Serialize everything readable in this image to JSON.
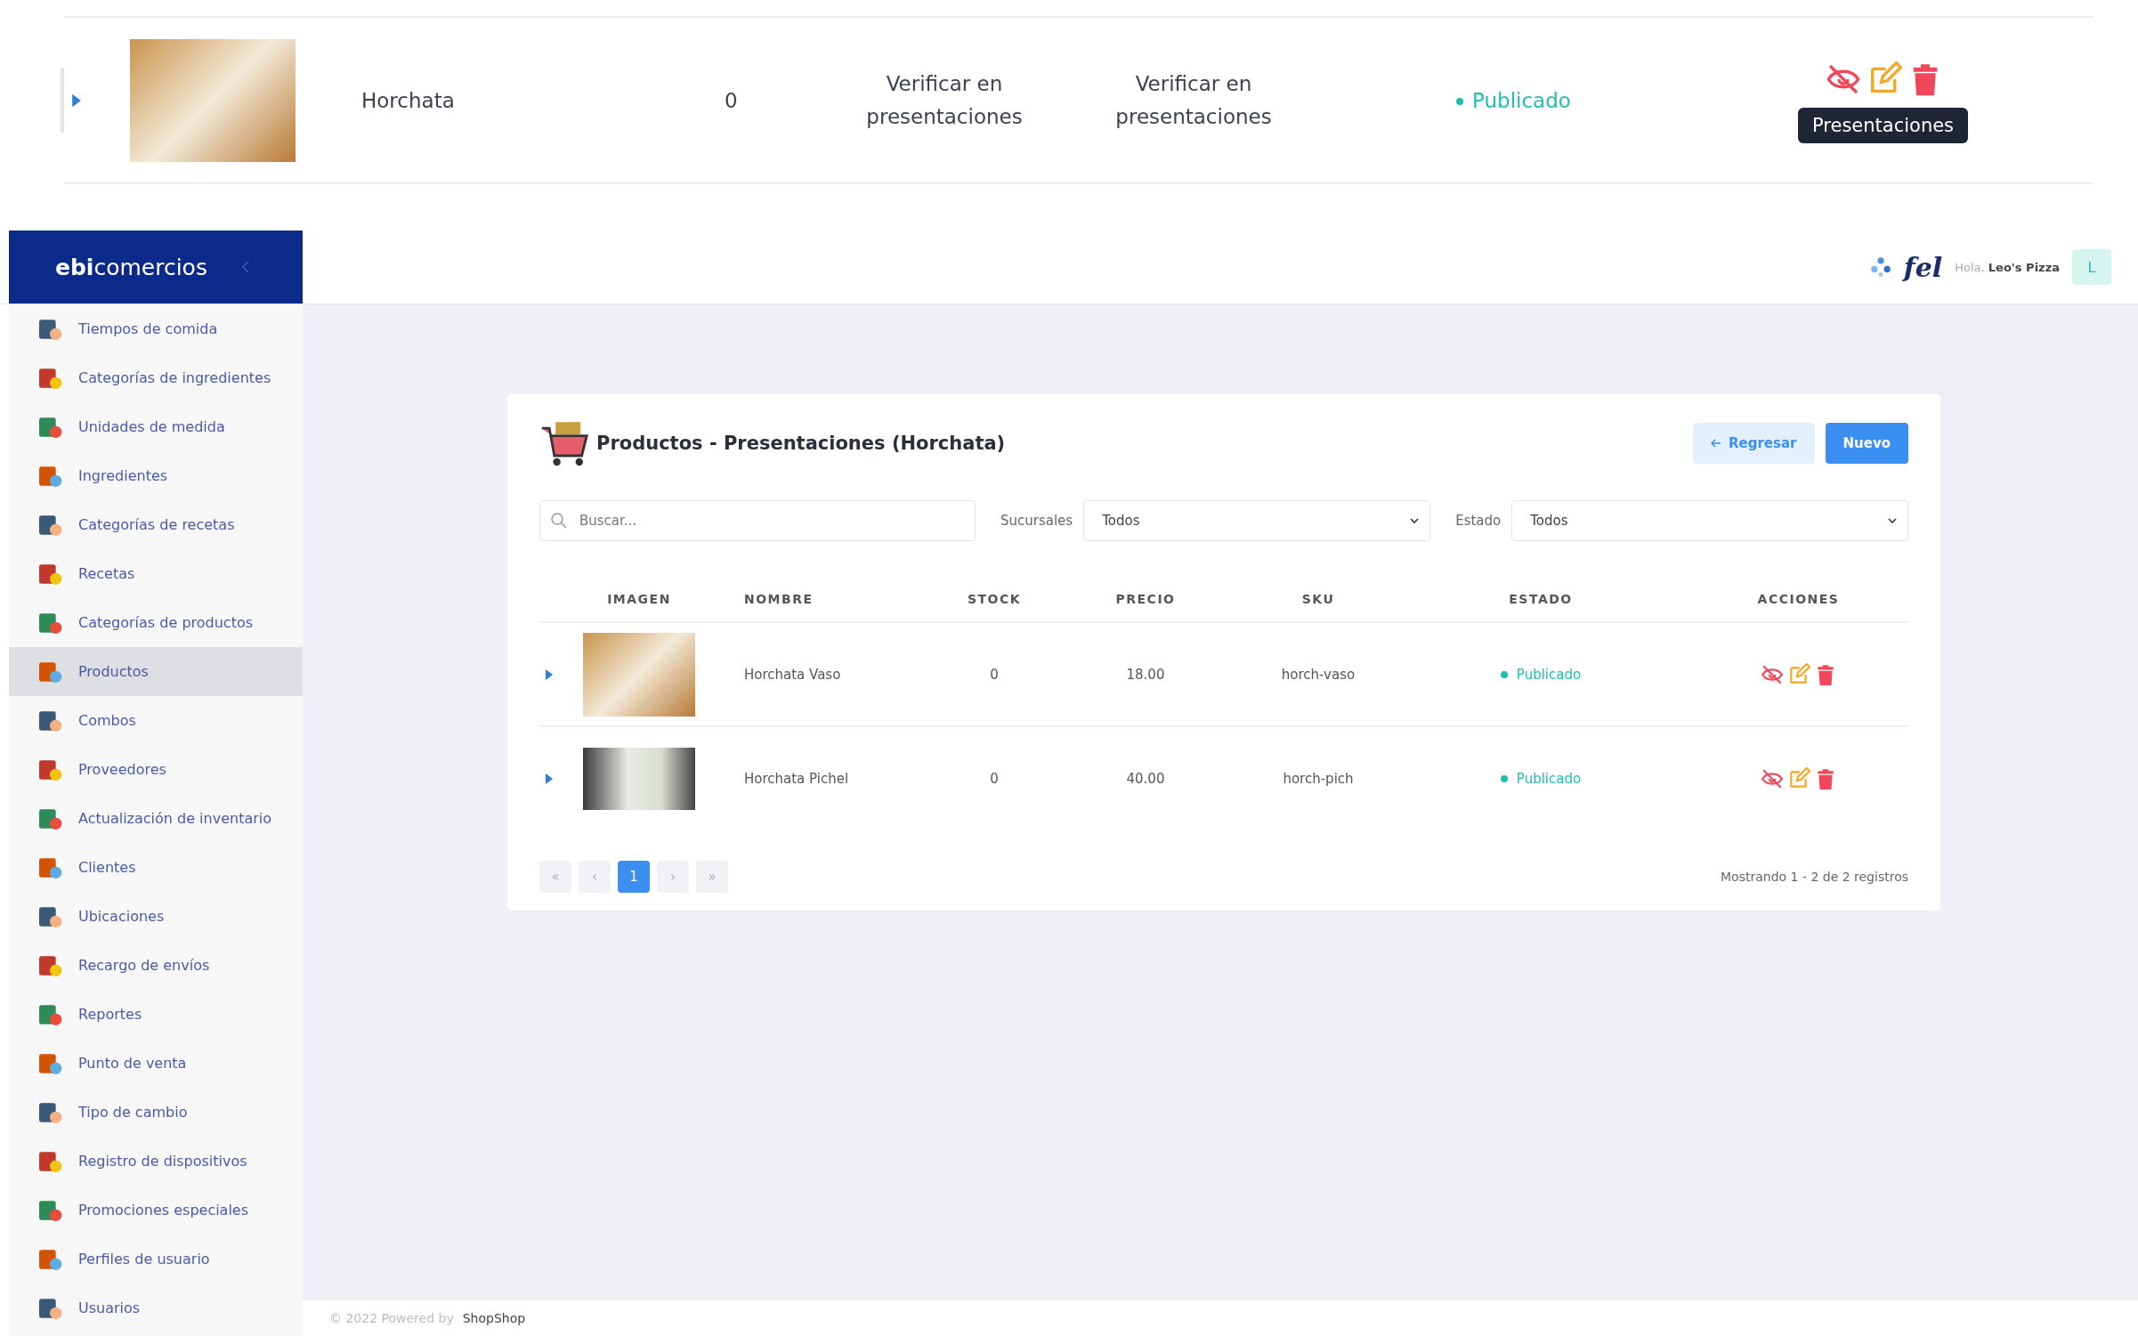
{
  "top_row": {
    "name": "Horchata",
    "stock": "0",
    "price": "Verificar en presentaciones",
    "sku": "Verificar en presentaciones",
    "status": "Publicado",
    "published": true,
    "tooltip": "Presentaciones"
  },
  "brand": {
    "logo": "**ebi**comercios"
  },
  "header": {
    "fel_logo": "fel",
    "greeting": "Hola,",
    "user_name": "Leo's Pizza",
    "avatar": "L"
  },
  "sidebar": {
    "items": [
      {
        "label": "Tiempos de comida",
        "selected": false
      },
      {
        "label": "Categorías de ingredientes",
        "selected": false
      },
      {
        "label": "Unidades de medida",
        "selected": false
      },
      {
        "label": "Ingredientes",
        "selected": false
      },
      {
        "label": "Categorías de recetas",
        "selected": false
      },
      {
        "label": "Recetas",
        "selected": false
      },
      {
        "label": "Categorías de productos",
        "selected": false
      },
      {
        "label": "Productos",
        "selected": true
      },
      {
        "label": "Combos",
        "selected": false
      },
      {
        "label": "Proveedores",
        "selected": false
      },
      {
        "label": "Actualización de inventario",
        "selected": false
      },
      {
        "label": "Clientes",
        "selected": false
      },
      {
        "label": "Ubicaciones",
        "selected": false
      },
      {
        "label": "Recargo de envíos",
        "selected": false
      },
      {
        "label": "Reportes",
        "selected": false
      },
      {
        "label": "Punto de venta",
        "selected": false
      },
      {
        "label": "Tipo de cambio",
        "selected": false
      },
      {
        "label": "Registro de dispositivos",
        "selected": false
      },
      {
        "label": "Promociones especiales",
        "selected": false
      },
      {
        "label": "Perfiles de usuario",
        "selected": false
      },
      {
        "label": "Usuarios",
        "selected": false
      }
    ]
  },
  "card": {
    "title": "Productos - Presentaciones (Horchata)",
    "back_button": "Regresar",
    "new_button": "Nuevo",
    "search": {
      "placeholder": "Buscar..."
    },
    "filters": [
      {
        "label": "Sucursales",
        "value": "Todos"
      },
      {
        "label": "Estado",
        "value": "Todos"
      }
    ],
    "table": {
      "columns": [
        "IMAGEN",
        "NOMBRE",
        "STOCK",
        "PRECIO",
        "SKU",
        "ESTADO",
        "ACCIONES"
      ],
      "rows": [
        {
          "name": "Horchata Vaso",
          "stock": "0",
          "price": "18.00",
          "sku": "horch-vaso",
          "status": "Publicado",
          "published": true
        },
        {
          "name": "Horchata Pichel",
          "stock": "0",
          "price": "40.00",
          "sku": "horch-pich",
          "status": "Publicado",
          "published": true
        }
      ]
    },
    "pagination": {
      "first": "«",
      "prev": "‹",
      "pages": [
        {
          "label": "1",
          "selected": true
        }
      ],
      "next": "›",
      "last": "»"
    },
    "info": "Mostrando 1 - 2 de 2 registros"
  },
  "footer": {
    "text": "© 2022 Powered by",
    "brand": "ShopShop"
  }
}
